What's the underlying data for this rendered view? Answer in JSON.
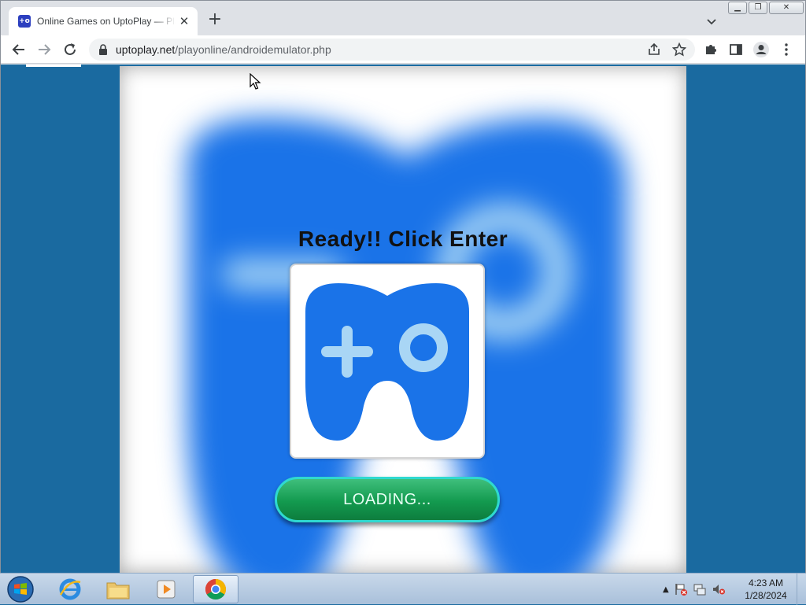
{
  "browser": {
    "tab_title": "Online Games on UptoPlay — Play",
    "favicon": "uptoplay-favicon",
    "new_tab_label": "+",
    "url_host": "uptoplay.net",
    "url_path": "/playonline/androidemulator.php"
  },
  "page": {
    "ready_text": "Ready!! Click Enter",
    "loading_label": "LOADING...",
    "logo_color": "#1a73e8",
    "background_color": "#1a6aa0",
    "button_color": "#139a4f"
  },
  "taskbar": {
    "clock_time": "4:23 AM",
    "clock_date": "1/28/2024",
    "apps": [
      "internet-explorer",
      "file-explorer",
      "media-player",
      "chrome"
    ]
  }
}
